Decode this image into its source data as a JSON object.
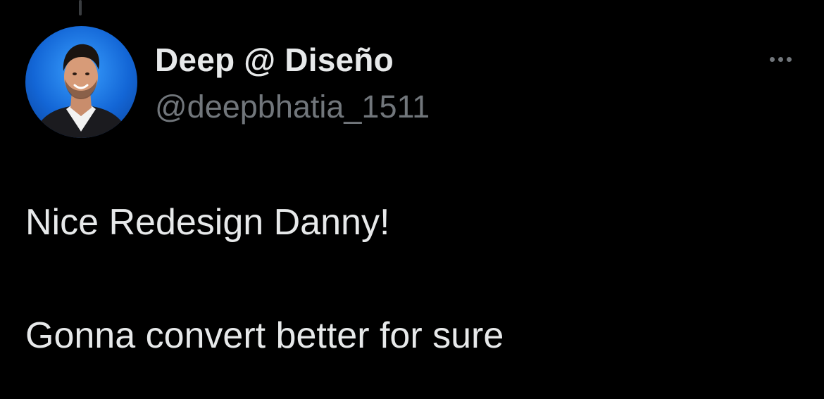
{
  "tweet": {
    "author": {
      "display_name": "Deep @ Diseño",
      "handle": "@deepbhatia_1511",
      "avatar_icon": "profile-photo-avatar"
    },
    "more_icon": "more-options-icon",
    "text_lines": [
      "Nice Redesign Danny!",
      "Gonna convert better for sure"
    ]
  },
  "colors": {
    "background": "#000000",
    "primary_text": "#e7e9ea",
    "secondary_text": "#71767b",
    "avatar_blue": "#1366d6"
  }
}
